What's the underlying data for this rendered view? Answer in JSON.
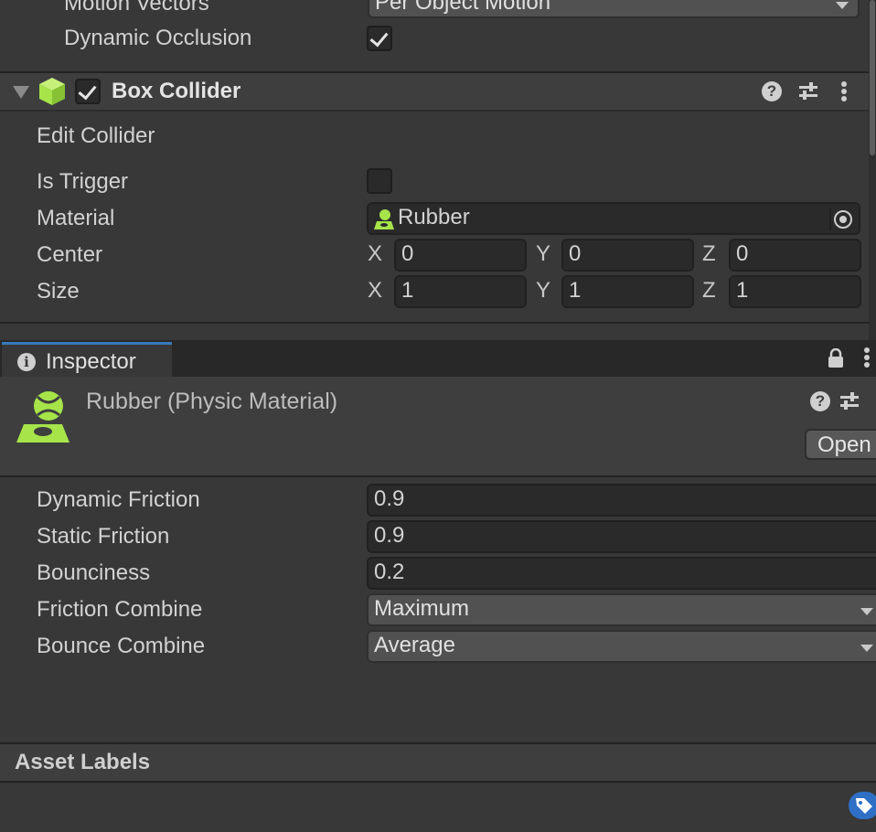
{
  "top_partial": {
    "motion_vectors_label": "Motion Vectors",
    "motion_vectors_value": "Per Object Motion",
    "dynamic_occlusion_label": "Dynamic Occlusion"
  },
  "box_collider": {
    "title": "Box Collider",
    "edit_collider_label": "Edit Collider",
    "is_trigger_label": "Is Trigger",
    "material_label": "Material",
    "material_value": "Rubber",
    "center_label": "Center",
    "size_label": "Size",
    "center": {
      "x_label": "X",
      "x": "0",
      "y_label": "Y",
      "y": "0",
      "z_label": "Z",
      "z": "0"
    },
    "size": {
      "x_label": "X",
      "x": "1",
      "y_label": "Y",
      "y": "1",
      "z_label": "Z",
      "z": "1"
    }
  },
  "inspector": {
    "tab_label": "Inspector",
    "asset_title": "Rubber (Physic Material)",
    "open_button": "Open",
    "properties": {
      "dynamic_friction_label": "Dynamic Friction",
      "dynamic_friction_value": "0.9",
      "static_friction_label": "Static Friction",
      "static_friction_value": "0.9",
      "bounciness_label": "Bounciness",
      "bounciness_value": "0.2",
      "friction_combine_label": "Friction Combine",
      "friction_combine_value": "Maximum",
      "bounce_combine_label": "Bounce Combine",
      "bounce_combine_value": "Average"
    },
    "asset_labels_title": "Asset Labels"
  },
  "colors": {
    "accent_green": "#a6e44a",
    "panel_bg": "#383838",
    "header_bg": "#3e3e3e",
    "tab_active_bg": "#383838",
    "tab_bar_bg": "#282828",
    "label_tag_blue": "#2f6fc6"
  }
}
